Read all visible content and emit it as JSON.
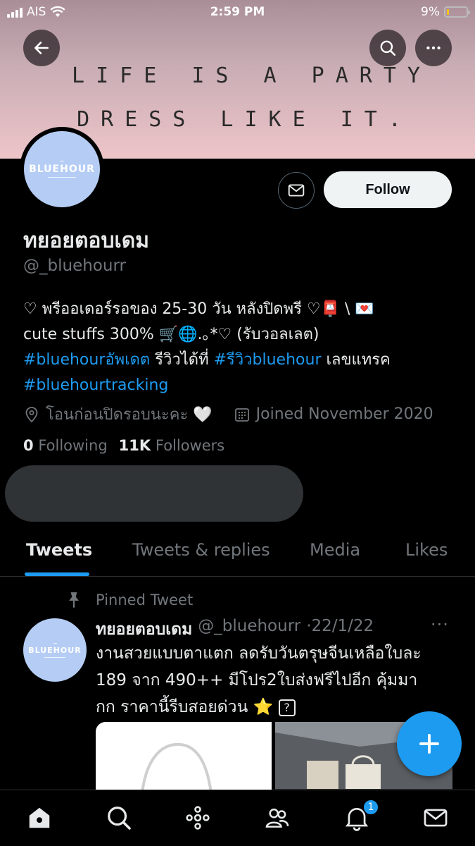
{
  "status_bar": {
    "carrier": "AIS",
    "time": "2:59 PM",
    "battery": "9%"
  },
  "banner": {
    "line1": "LIFE IS A PARTY",
    "line2": "DRESS LIKE IT."
  },
  "profile": {
    "avatar_text": "BLUEHOUR",
    "display_name": "ทยอยตอบเดม",
    "handle": "@_bluehourr",
    "follow_label": "Follow",
    "bio_line1": "♡ พรีออเดอร์รอของ 25-30 วัน หลังปิดพรี ♡📮 \\ 💌",
    "bio_line2": "cute stuffs 300% 🛒🌐.｡*♡ (รับวอลเลต)",
    "bio_tag1": "#bluehourอัพเดต",
    "bio_text3": " รีวิวได้ที่ ",
    "bio_tag2": "#รีวิวbluehour",
    "bio_text4": " เลขแทรค",
    "bio_tag3": "#bluehourtracking",
    "location": "โอนก่อนปิดรอบนะคะ 🤍",
    "joined": "Joined November 2020",
    "following_count": "0",
    "following_label": "Following",
    "followers_count": "11K",
    "followers_label": "Followers"
  },
  "tabs": [
    {
      "label": "Tweets",
      "active": true
    },
    {
      "label": "Tweets & replies",
      "active": false
    },
    {
      "label": "Media",
      "active": false
    },
    {
      "label": "Likes",
      "active": false
    }
  ],
  "tweet": {
    "pinned_label": "Pinned Tweet",
    "avatar_text": "BLUEHOUR",
    "name": "ทยอยตอบเดม",
    "handle": "@_bluehourr",
    "date": "·22/1/22",
    "more": "···",
    "text_line1": "งานสวยแบบตาแตก ลดรับวันตรุษจีนเหลือใบละ",
    "text_line2": "189 จาก 490++ มีโปร2ใบส่งฟรีไปอีก คุ้มมา",
    "text_line3": "กก ราคานี้รีบสอยด่วน",
    "star": "⭐",
    "box": "?"
  },
  "nav": {
    "notifications_badge": "1"
  },
  "icons": [
    "back-arrow-icon",
    "search-icon",
    "more-icon",
    "mail-icon",
    "location-icon",
    "calendar-icon",
    "pin-icon",
    "home-icon",
    "explore-icon",
    "spaces-icon",
    "communities-icon",
    "bell-icon",
    "compose-icon"
  ],
  "colors": {
    "accent": "#1d9bf0",
    "bg": "#000000",
    "muted": "#71767b"
  }
}
